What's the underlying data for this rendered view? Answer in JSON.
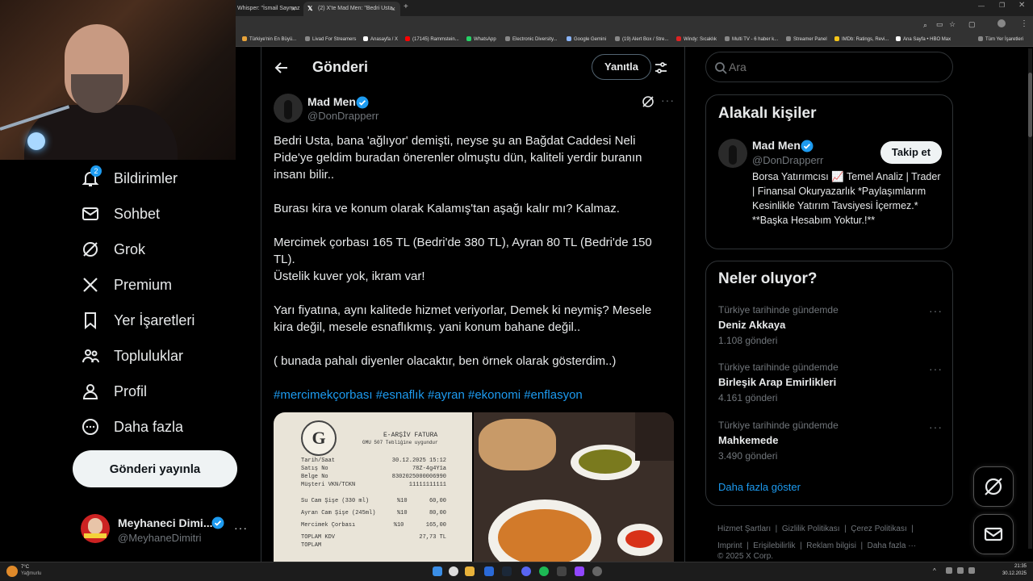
{
  "browser": {
    "tabs": [
      {
        "title": "Whisper: \"İsmail Saymaz"
      },
      {
        "title": "(2) X'te Mad Men: \"Bedri Usta,"
      }
    ],
    "new_tab": "+",
    "bookmarks": [
      {
        "label": "Türkiye'nin En Büyü..."
      },
      {
        "label": "Livad For Streamers"
      },
      {
        "label": "Anasayfa / X"
      },
      {
        "label": "(17145) Rammstein..."
      },
      {
        "label": "WhatsApp"
      },
      {
        "label": "Electronic Diversity..."
      },
      {
        "label": "Google Gemini"
      },
      {
        "label": "(19) Alert Box / Stre..."
      },
      {
        "label": "Windy: Sıcaklık"
      },
      {
        "label": "Multi TV - 6 haber k..."
      },
      {
        "label": "Streamer Panel"
      },
      {
        "label": "IMDb: Ratings, Revi..."
      },
      {
        "label": "Ana Sayfa • HBO Max"
      },
      {
        "label": "Tüm Yer İşaretleri"
      }
    ]
  },
  "nav": {
    "notifications_badge": "2",
    "items": [
      {
        "label": "Bildirimler",
        "icon": "bell-icon"
      },
      {
        "label": "Sohbet",
        "icon": "mail-icon"
      },
      {
        "label": "Grok",
        "icon": "grok-icon"
      },
      {
        "label": "Premium",
        "icon": "x-logo-icon"
      },
      {
        "label": "Yer İşaretleri",
        "icon": "bookmark-icon"
      },
      {
        "label": "Topluluklar",
        "icon": "people-icon"
      },
      {
        "label": "Profil",
        "icon": "person-icon"
      },
      {
        "label": "Daha fazla",
        "icon": "more-circle-icon"
      }
    ],
    "post_button": "Gönderi yayınla",
    "account": {
      "name": "Meyhaneci Dimi...",
      "handle": "@MeyhaneDimitri"
    }
  },
  "post": {
    "header_title": "Gönderi",
    "reply_button": "Yanıtla",
    "author_name": "Mad Men",
    "author_handle": "@DonDrapperr",
    "paragraphs": [
      "Bedri Usta, bana 'ağlıyor' demişti, neyse şu an Bağdat Caddesi Neli Pide'ye geldim buradan önerenler olmuştu dün, kaliteli yerdir buranın insanı bilir..",
      "Burası kira ve konum olarak Kalamış'tan aşağı kalır mı? Kalmaz.",
      "Mercimek çorbası 165 TL (Bedri'de 380 TL), Ayran 80 TL (Bedri'de 150 TL).",
      "Üstelik kuver yok, ikram var!",
      "Yarı fiyatına, aynı kalitede hizmet veriyorlar, Demek ki neymiş? Mesele kira değil, mesele esnaflıkmış. yani konum bahane değil..",
      "( bunada pahalı diyenler olacaktır, ben örnek olarak gösterdim..)"
    ],
    "hashtags": [
      "#mercimekçorbası",
      "#esnaflık",
      "#ayran",
      "#ekonomi",
      "#enflasyon"
    ],
    "receipt": {
      "title": "E-ARŞİV FATURA",
      "subtitle": "GMU 507 Tebliğine uygundur",
      "rows": [
        [
          "Tarih/Saat",
          "30.12.2025 15:12"
        ],
        [
          "Satış No",
          "78Z-4g4Y1a"
        ],
        [
          "Belge No",
          "8302025000006990"
        ],
        [
          "Müşteri VKN/TCKN",
          "11111111111"
        ]
      ],
      "items": [
        [
          "Su Cam Şişe (330 ml)",
          "%10",
          "60,00"
        ],
        [
          "Ayran Cam Şişe (245ml)",
          "%10",
          "80,00"
        ],
        [
          "Mercimek Çorbası",
          "%10",
          "165,00"
        ]
      ],
      "total_label": "TOPLAM KDV",
      "total_value": "27,73 TL",
      "grand_label": "TOPLAM"
    }
  },
  "sidebar": {
    "search_placeholder": "Ara",
    "related_title": "Alakalı kişiler",
    "related": {
      "name": "Mad Men",
      "handle": "@DonDrapperr",
      "follow": "Takip et",
      "bio": "Borsa Yatırımcısı 📈 Temel Analiz | Trader | Finansal Okuryazarlık *Paylaşımlarım Kesinlikle Yatırım Tavsiyesi İçermez.* **Başka Hesabım Yoktur.!**"
    },
    "trends_title": "Neler oluyor?",
    "trends": [
      {
        "meta": "Türkiye tarihinde gündemde",
        "title": "Deniz Akkaya",
        "count": "1.108 gönderi"
      },
      {
        "meta": "Türkiye tarihinde gündemde",
        "title": "Birleşik Arap Emirlikleri",
        "count": "4.161 gönderi"
      },
      {
        "meta": "Türkiye tarihinde gündemde",
        "title": "Mahkemede",
        "count": "3.490 gönderi"
      }
    ],
    "show_more": "Daha fazla göster",
    "footer": {
      "links": [
        "Hizmet Şartları",
        "Gizlilik Politikası",
        "Çerez Politikası",
        "Imprint",
        "Erişilebilirlik",
        "Reklam bilgisi",
        "Daha fazla ···"
      ],
      "copyright": "© 2025 X Corp."
    }
  },
  "taskbar": {
    "weather_temp": "7°C",
    "weather_desc": "Yağmurlu",
    "time": "21:35",
    "date": "30.12.2025"
  }
}
